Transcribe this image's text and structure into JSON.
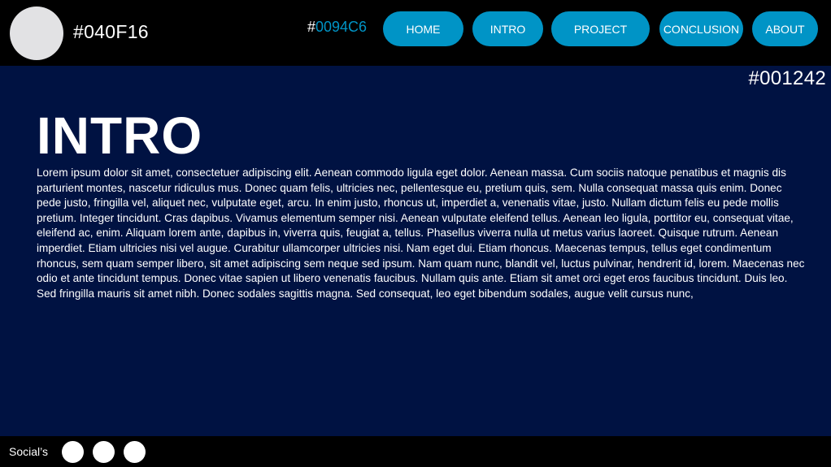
{
  "header": {
    "brand_color_label": "#040F16",
    "accent_label_hash": "#",
    "accent_label_value": "0094C6",
    "nav": [
      {
        "label": "HOME"
      },
      {
        "label": "INTRO"
      },
      {
        "label": "PROJECT"
      },
      {
        "label": "CONCLUSION"
      },
      {
        "label": "ABOUT"
      }
    ]
  },
  "main": {
    "color_label": "#001242",
    "title": "INTRO",
    "body": "Lorem ipsum dolor sit amet, consectetuer adipiscing elit. Aenean commodo ligula eget dolor. Aenean massa. Cum sociis natoque penatibus et magnis dis parturient montes, nascetur ridiculus mus. Donec quam felis, ultricies nec, pellentesque eu, pretium quis, sem. Nulla consequat massa quis enim. Donec pede justo, fringilla vel, aliquet nec, vulputate eget, arcu. In enim justo, rhoncus ut, imperdiet a, venenatis vitae, justo. Nullam dictum felis eu pede mollis pretium. Integer tincidunt. Cras dapibus. Vivamus elementum semper nisi. Aenean vulputate eleifend tellus. Aenean leo ligula, porttitor eu, consequat vitae, eleifend ac, enim. Aliquam lorem ante, dapibus in, viverra quis, feugiat a, tellus. Phasellus viverra nulla ut metus varius laoreet. Quisque rutrum. Aenean imperdiet. Etiam ultricies nisi vel augue. Curabitur ullamcorper ultricies nisi. Nam eget dui. Etiam rhoncus. Maecenas tempus, tellus eget condimentum rhoncus, sem quam semper libero, sit amet adipiscing sem neque sed ipsum. Nam quam nunc, blandit vel, luctus pulvinar, hendrerit id, lorem. Maecenas nec odio et ante tincidunt tempus. Donec vitae sapien ut libero venenatis faucibus. Nullam quis ante. Etiam sit amet orci eget eros faucibus tincidunt. Duis leo. Sed fringilla mauris sit amet nibh. Donec sodales sagittis magna. Sed consequat, leo eget bibendum sodales, augue velit cursus nunc,"
  },
  "footer": {
    "socials_label": "Social’s"
  },
  "colors": {
    "page": "#040F16",
    "header": "#000000",
    "accent": "#0094C6",
    "main": "#001242",
    "text": "#FFFFFF"
  }
}
